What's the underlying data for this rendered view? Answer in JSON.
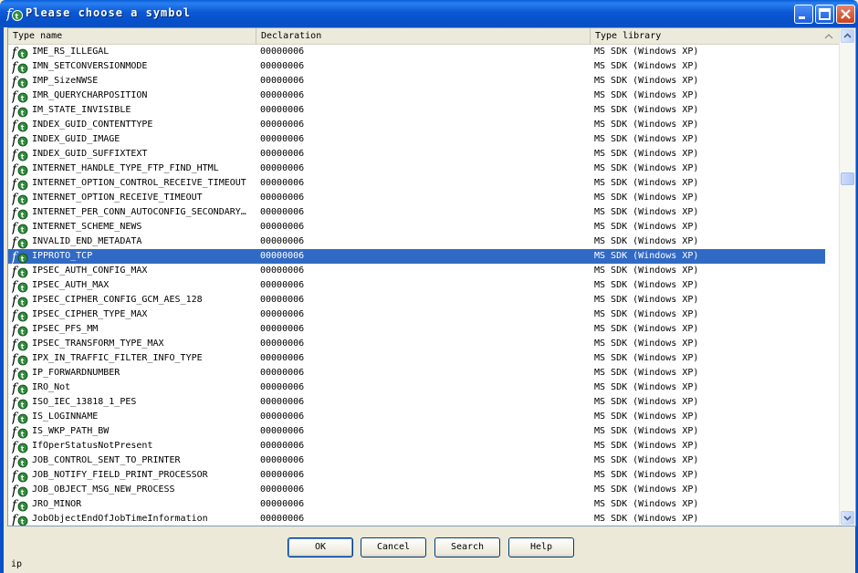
{
  "window": {
    "title": "Please choose a symbol"
  },
  "columns": [
    "Type name",
    "Declaration",
    "Type library"
  ],
  "rows": [
    {
      "name": "IME_RS_ILLEGAL",
      "decl": "00000006",
      "lib": "MS SDK (Windows XP)"
    },
    {
      "name": "IMN_SETCONVERSIONMODE",
      "decl": "00000006",
      "lib": "MS SDK (Windows XP)"
    },
    {
      "name": "IMP_SizeNWSE",
      "decl": "00000006",
      "lib": "MS SDK (Windows XP)"
    },
    {
      "name": "IMR_QUERYCHARPOSITION",
      "decl": "00000006",
      "lib": "MS SDK (Windows XP)"
    },
    {
      "name": "IM_STATE_INVISIBLE",
      "decl": "00000006",
      "lib": "MS SDK (Windows XP)"
    },
    {
      "name": "INDEX_GUID_CONTENTTYPE",
      "decl": "00000006",
      "lib": "MS SDK (Windows XP)"
    },
    {
      "name": "INDEX_GUID_IMAGE",
      "decl": "00000006",
      "lib": "MS SDK (Windows XP)"
    },
    {
      "name": "INDEX_GUID_SUFFIXTEXT",
      "decl": "00000006",
      "lib": "MS SDK (Windows XP)"
    },
    {
      "name": "INTERNET_HANDLE_TYPE_FTP_FIND_HTML",
      "decl": "00000006",
      "lib": "MS SDK (Windows XP)"
    },
    {
      "name": "INTERNET_OPTION_CONTROL_RECEIVE_TIMEOUT",
      "decl": "00000006",
      "lib": "MS SDK (Windows XP)"
    },
    {
      "name": "INTERNET_OPTION_RECEIVE_TIMEOUT",
      "decl": "00000006",
      "lib": "MS SDK (Windows XP)"
    },
    {
      "name": "INTERNET_PER_CONN_AUTOCONFIG_SECONDARY…",
      "decl": "00000006",
      "lib": "MS SDK (Windows XP)"
    },
    {
      "name": "INTERNET_SCHEME_NEWS",
      "decl": "00000006",
      "lib": "MS SDK (Windows XP)"
    },
    {
      "name": "INVALID_END_METADATA",
      "decl": "00000006",
      "lib": "MS SDK (Windows XP)"
    },
    {
      "name": "IPPROTO_TCP",
      "decl": "00000006",
      "lib": "MS SDK (Windows XP)",
      "selected": true
    },
    {
      "name": "IPSEC_AUTH_CONFIG_MAX",
      "decl": "00000006",
      "lib": "MS SDK (Windows XP)"
    },
    {
      "name": "IPSEC_AUTH_MAX",
      "decl": "00000006",
      "lib": "MS SDK (Windows XP)"
    },
    {
      "name": "IPSEC_CIPHER_CONFIG_GCM_AES_128",
      "decl": "00000006",
      "lib": "MS SDK (Windows XP)"
    },
    {
      "name": "IPSEC_CIPHER_TYPE_MAX",
      "decl": "00000006",
      "lib": "MS SDK (Windows XP)"
    },
    {
      "name": "IPSEC_PFS_MM",
      "decl": "00000006",
      "lib": "MS SDK (Windows XP)"
    },
    {
      "name": "IPSEC_TRANSFORM_TYPE_MAX",
      "decl": "00000006",
      "lib": "MS SDK (Windows XP)"
    },
    {
      "name": "IPX_IN_TRAFFIC_FILTER_INFO_TYPE",
      "decl": "00000006",
      "lib": "MS SDK (Windows XP)"
    },
    {
      "name": "IP_FORWARDNUMBER",
      "decl": "00000006",
      "lib": "MS SDK (Windows XP)"
    },
    {
      "name": "IRO_Not",
      "decl": "00000006",
      "lib": "MS SDK (Windows XP)"
    },
    {
      "name": "ISO_IEC_13818_1_PES",
      "decl": "00000006",
      "lib": "MS SDK (Windows XP)"
    },
    {
      "name": "IS_LOGINNAME",
      "decl": "00000006",
      "lib": "MS SDK (Windows XP)"
    },
    {
      "name": "IS_WKP_PATH_BW",
      "decl": "00000006",
      "lib": "MS SDK (Windows XP)"
    },
    {
      "name": "IfOperStatusNotPresent",
      "decl": "00000006",
      "lib": "MS SDK (Windows XP)"
    },
    {
      "name": "JOB_CONTROL_SENT_TO_PRINTER",
      "decl": "00000006",
      "lib": "MS SDK (Windows XP)"
    },
    {
      "name": "JOB_NOTIFY_FIELD_PRINT_PROCESSOR",
      "decl": "00000006",
      "lib": "MS SDK (Windows XP)"
    },
    {
      "name": "JOB_OBJECT_MSG_NEW_PROCESS",
      "decl": "00000006",
      "lib": "MS SDK (Windows XP)"
    },
    {
      "name": "JRO_MINOR",
      "decl": "00000006",
      "lib": "MS SDK (Windows XP)"
    },
    {
      "name": "JobObjectEndOfJobTimeInformation",
      "decl": "00000006",
      "lib": "MS SDK (Windows XP)"
    }
  ],
  "buttons": {
    "ok": "OK",
    "cancel": "Cancel",
    "search": "Search",
    "help": "Help"
  },
  "filter_text": "ip",
  "colors": {
    "selection": "#316ac5",
    "titlebar": "#0a5ed8"
  },
  "icons": {
    "title": "ft-symbol-icon",
    "row": "ft-symbol-icon"
  }
}
